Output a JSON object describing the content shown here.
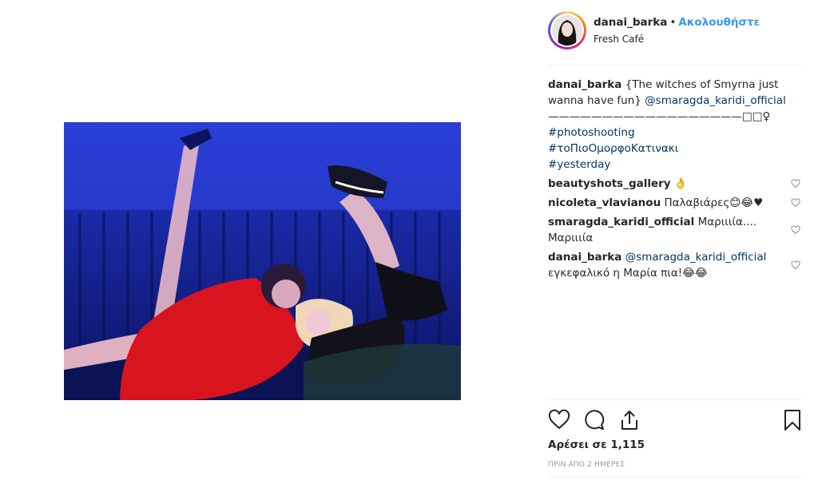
{
  "post": {
    "username": "danai_barka",
    "separator": "•",
    "follow_label": "Ακολουθήστε",
    "location": "Fresh Café",
    "caption": {
      "username": "danai_barka",
      "line1": "{The witches of Smyrna just",
      "line2_text": "wanna have fun}",
      "line2_mention": "@smaragda_karidi_official",
      "line3": "——————————————————□□♀",
      "hashtags": [
        "#photoshooting",
        "#τοΠιοΟμορφοΚατινακι",
        "#yesterday"
      ]
    },
    "comments": [
      {
        "username": "beautyshots_gallery",
        "text": "👌"
      },
      {
        "username": "nicoleta_vlavianou",
        "text": "Παλαβιάρες😊😂♥"
      },
      {
        "username": "smaragda_karidi_official",
        "text": "Μαριιιία.... Μαριιιία"
      },
      {
        "username": "danai_barka",
        "mention": "@smaragda_karidi_official",
        "text": "εγκεφαλικό η Μαρία πια!😂😂"
      }
    ],
    "likes": "Αρέσει σε 1,115",
    "time": "ΠΡΙΝ ΑΠΟ 2 ΗΜΕΡΕΣ"
  },
  "icons": {
    "like": "heart-icon",
    "comment": "comment-bubble-icon",
    "share": "share-icon",
    "save": "bookmark-icon"
  },
  "colors": {
    "accent": "#3897f0",
    "link": "#003569",
    "muted": "#999999",
    "photo_blue": "#2230c8",
    "dress_red": "#d8141e"
  }
}
